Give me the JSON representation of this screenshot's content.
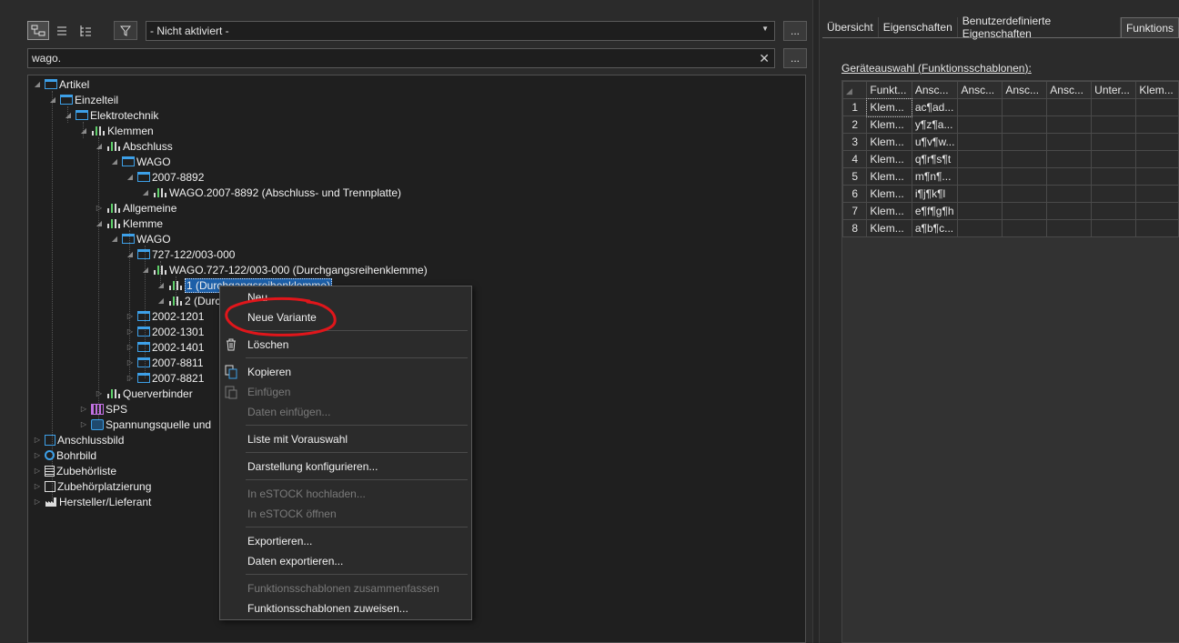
{
  "toolbar": {
    "filter_value": "- Nicht aktiviert -",
    "more_label": "...",
    "search_value": "wago.",
    "clear_label": "✕",
    "more2_label": "..."
  },
  "tree": {
    "n0": "Artikel",
    "n1": "Einzelteil",
    "n2": "Elektrotechnik",
    "n3": "Klemmen",
    "n4": "Abschluss",
    "n5": "WAGO",
    "n6": "2007-8892",
    "n7": "WAGO.2007-8892 (Abschluss- und Trennplatte)",
    "n8": "Allgemeine",
    "n9": "Klemme",
    "n10": "WAGO",
    "n11": "727-122/003-000",
    "n12": "WAGO.727-122/003-000 (Durchgangsreihenklemme)",
    "n13": "1 (Durchgangsreihenklemme)",
    "n14": "2 (Durc",
    "n15": "2002-1201",
    "n16": "2002-1301",
    "n17": "2002-1401",
    "n18": "2007-8811",
    "n19": "2007-8821",
    "n20": "Querverbinder",
    "n21": "SPS",
    "n22": "Spannungsquelle und",
    "n23": "Anschlussbild",
    "n24": "Bohrbild",
    "n25": "Zubehörliste",
    "n26": "Zubehörplatzierung",
    "n27": "Hersteller/Lieferant"
  },
  "context_menu": {
    "neu": "Neu",
    "neue_variante": "Neue Variante",
    "loeschen": "Löschen",
    "kopieren": "Kopieren",
    "einfuegen": "Einfügen",
    "daten_einfuegen": "Daten einfügen...",
    "liste": "Liste mit Vorauswahl",
    "darstellung": "Darstellung konfigurieren...",
    "estock_hoch": "In eSTOCK hochladen...",
    "estock_oeffnen": "In eSTOCK öffnen",
    "exportieren": "Exportieren...",
    "daten_exportieren": "Daten exportieren...",
    "zusammenfassen": "Funktionsschablonen zusammenfassen",
    "zuweisen": "Funktionsschablonen zuweisen..."
  },
  "right_panel": {
    "tabs": [
      "Übersicht",
      "Eigenschaften",
      "Benutzerdefinierte Eigenschaften",
      "Funktions"
    ],
    "section_label": "Geräteauswahl (Funktionsschablonen):",
    "columns": [
      "Funkt...",
      "Ansc...",
      "Ansc...",
      "Ansc...",
      "Ansc...",
      "Unter...",
      "Klem..."
    ],
    "rows": [
      [
        "1",
        "Klem...",
        "ac¶ad..."
      ],
      [
        "2",
        "Klem...",
        "y¶z¶a..."
      ],
      [
        "3",
        "Klem...",
        "u¶v¶w..."
      ],
      [
        "4",
        "Klem...",
        "q¶r¶s¶t"
      ],
      [
        "5",
        "Klem...",
        "m¶n¶..."
      ],
      [
        "6",
        "Klem...",
        "i¶j¶k¶l"
      ],
      [
        "7",
        "Klem...",
        "e¶f¶g¶h"
      ],
      [
        "8",
        "Klem...",
        "a¶b¶c..."
      ]
    ]
  },
  "colors": {
    "selection": "#1c5fa8",
    "annotation_circle": "#e0161b",
    "folder": "#3da0e8"
  }
}
